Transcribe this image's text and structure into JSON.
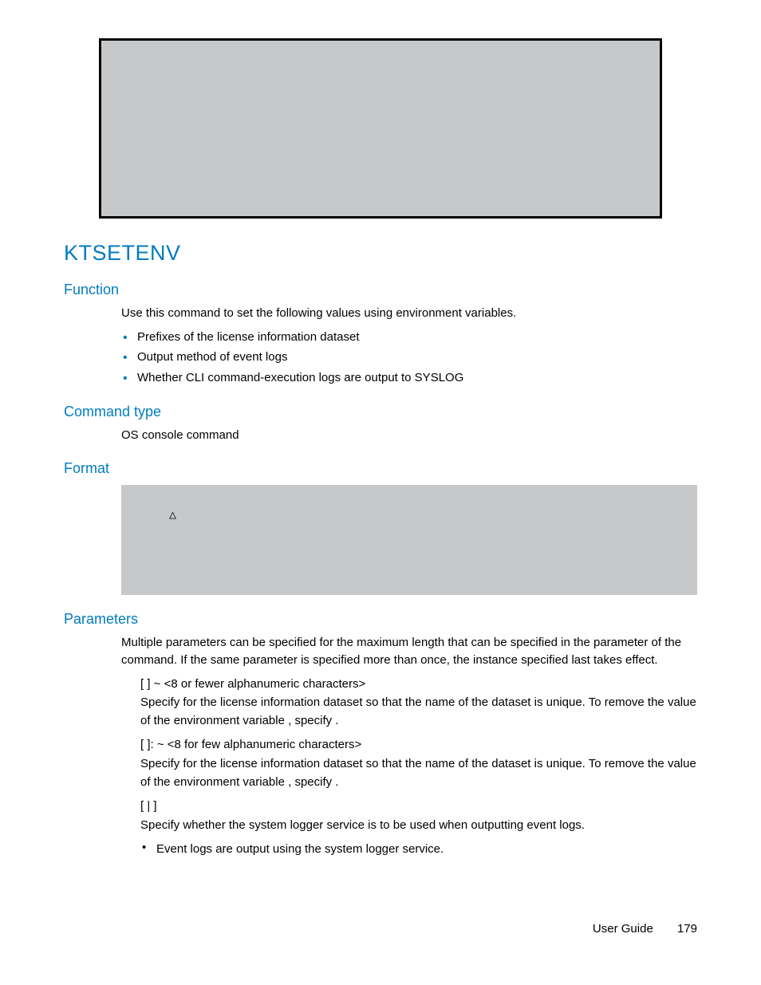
{
  "title": "KTSETENV",
  "sections": {
    "function": {
      "heading": "Function",
      "intro": "Use this command to set the following values using environment variables.",
      "bullets": [
        "Prefixes of the license information dataset",
        "Output method of event logs",
        "Whether CLI command-execution logs are output to SYSLOG"
      ]
    },
    "command_type": {
      "heading": "Command type",
      "text": "OS console command"
    },
    "format": {
      "heading": "Format",
      "delta": "△"
    },
    "parameters": {
      "heading": "Parameters",
      "intro": "Multiple parameters can be specified for the maximum length that can be specified in the parameter of the              command. If the same parameter is specified more than once, the instance specified last takes effect.",
      "p1_head": "             [                 ] ~ <8 or fewer alphanumeric characters>",
      "p1_desc": "Specify                 for the license information dataset so that the name of the dataset is unique. To remove the value of the environment variable                 , specify                                .",
      "p2_head": "             [                 ]: ~ <8 for few alphanumeric characters>",
      "p2_desc": "Specify                 for the license information dataset so that the name of the dataset is unique. To remove the value of the environment variable                 , specify                                .",
      "p3_head": "      [        |       ]",
      "p3_desc": "Specify whether the system logger service is to be used when outputting event logs.",
      "p3_sub": "Event logs are output using the system logger service."
    }
  },
  "footer": {
    "guide": "User Guide",
    "page": "179"
  }
}
